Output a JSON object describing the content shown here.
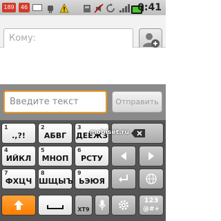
{
  "status_bar": {
    "badge_1": "189",
    "badge_2": "46",
    "time": "0:41"
  },
  "compose": {
    "to_placeholder": "Кому:",
    "message_placeholder": "Введите текст",
    "send_label": "Отправить"
  },
  "keyboard": {
    "keys": [
      {
        "num": "1",
        "label": ".,?!"
      },
      {
        "num": "2",
        "label": "АБВГ"
      },
      {
        "num": "3",
        "label": "ДЕЁЖЗ"
      },
      {
        "num": "4",
        "label": "ИЙКЛ"
      },
      {
        "num": "5",
        "label": "МНОП"
      },
      {
        "num": "6",
        "label": "РСТУ"
      },
      {
        "num": "7",
        "label": "ФХЦЧ"
      },
      {
        "num": "8",
        "label": "ШЩЫЪ"
      },
      {
        "num": "9",
        "label": "ЬЭЮЯ"
      }
    ],
    "t9_label": "XT9",
    "mode_label_top": "123",
    "mode_label_bottom": "@#+"
  },
  "watermark": "mobiset.ru",
  "colors": {
    "accent": "#ff8a00",
    "field_focus": "#f0961e",
    "keyboard_bg": "#555555",
    "compose_bg": "#8a8a8a"
  },
  "icons": [
    "contact-add-icon",
    "backspace-icon",
    "arrow-left-icon",
    "arrow-right-icon",
    "enter-icon",
    "globe-icon",
    "shift-icon",
    "space-icon",
    "mic-icon",
    "settings-icon"
  ]
}
